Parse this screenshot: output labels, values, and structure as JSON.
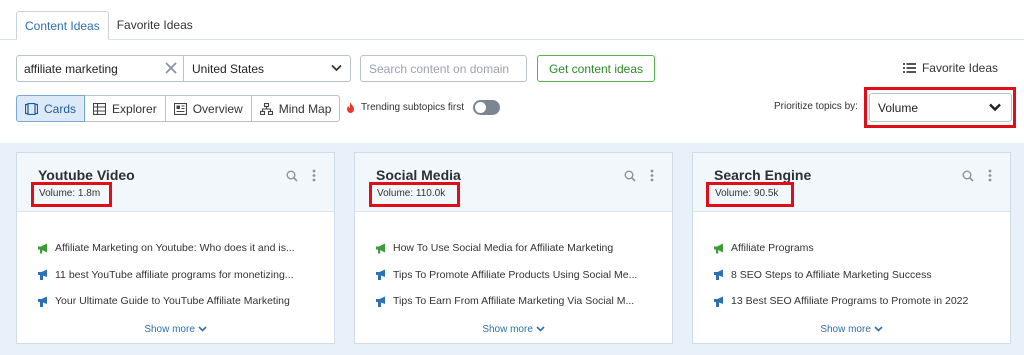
{
  "tabs": [
    {
      "label": "Content Ideas",
      "active": true
    },
    {
      "label": "Favorite Ideas",
      "active": false
    }
  ],
  "search": {
    "keyword_value": "affiliate marketing",
    "country": "United States",
    "domain_placeholder": "Search content on domain",
    "get_button": "Get content ideas"
  },
  "favorite_link": "Favorite Ideas",
  "views": [
    {
      "label": "Cards",
      "icon": "cards-icon",
      "active": true
    },
    {
      "label": "Explorer",
      "icon": "table-icon",
      "active": false
    },
    {
      "label": "Overview",
      "icon": "overview-icon",
      "active": false
    },
    {
      "label": "Mind Map",
      "icon": "mindmap-icon",
      "active": false
    }
  ],
  "trending": {
    "label": "Trending subtopics first",
    "enabled": false
  },
  "prioritize": {
    "label": "Prioritize topics by:",
    "value": "Volume"
  },
  "cards": [
    {
      "title": "Youtube Video",
      "volume": "Volume: 1.8m",
      "items": [
        {
          "icon": "megaphone-icon",
          "text": "Affiliate Marketing on Youtube: Who does it and is..."
        },
        {
          "icon": "article-icon",
          "text": "11 best YouTube affiliate programs for monetizing..."
        },
        {
          "icon": "article-icon",
          "text": "Your Ultimate Guide to YouTube Affiliate Marketing"
        }
      ],
      "show_more": "Show more"
    },
    {
      "title": "Social Media",
      "volume": "Volume: 110.0k",
      "items": [
        {
          "icon": "megaphone-icon",
          "text": "How To Use Social Media for Affiliate Marketing"
        },
        {
          "icon": "article-icon",
          "text": "Tips To Promote Affiliate Products Using Social Me..."
        },
        {
          "icon": "article-icon",
          "text": "Tips To Earn From Affiliate Marketing Via Social M..."
        }
      ],
      "show_more": "Show more"
    },
    {
      "title": "Search Engine",
      "volume": "Volume: 90.5k",
      "items": [
        {
          "icon": "megaphone-icon",
          "text": "Affiliate Programs"
        },
        {
          "icon": "article-icon",
          "text": "8 SEO Steps to Affiliate Marketing Success"
        },
        {
          "icon": "article-icon",
          "text": "13 Best SEO Affiliate Programs to Promote in 2022"
        }
      ],
      "show_more": "Show more"
    }
  ],
  "colors": {
    "accent_blue": "#2f6fb3",
    "green_button": "#56b24d",
    "highlight_red": "#e10e17",
    "content_bg": "#e8f1fa"
  }
}
